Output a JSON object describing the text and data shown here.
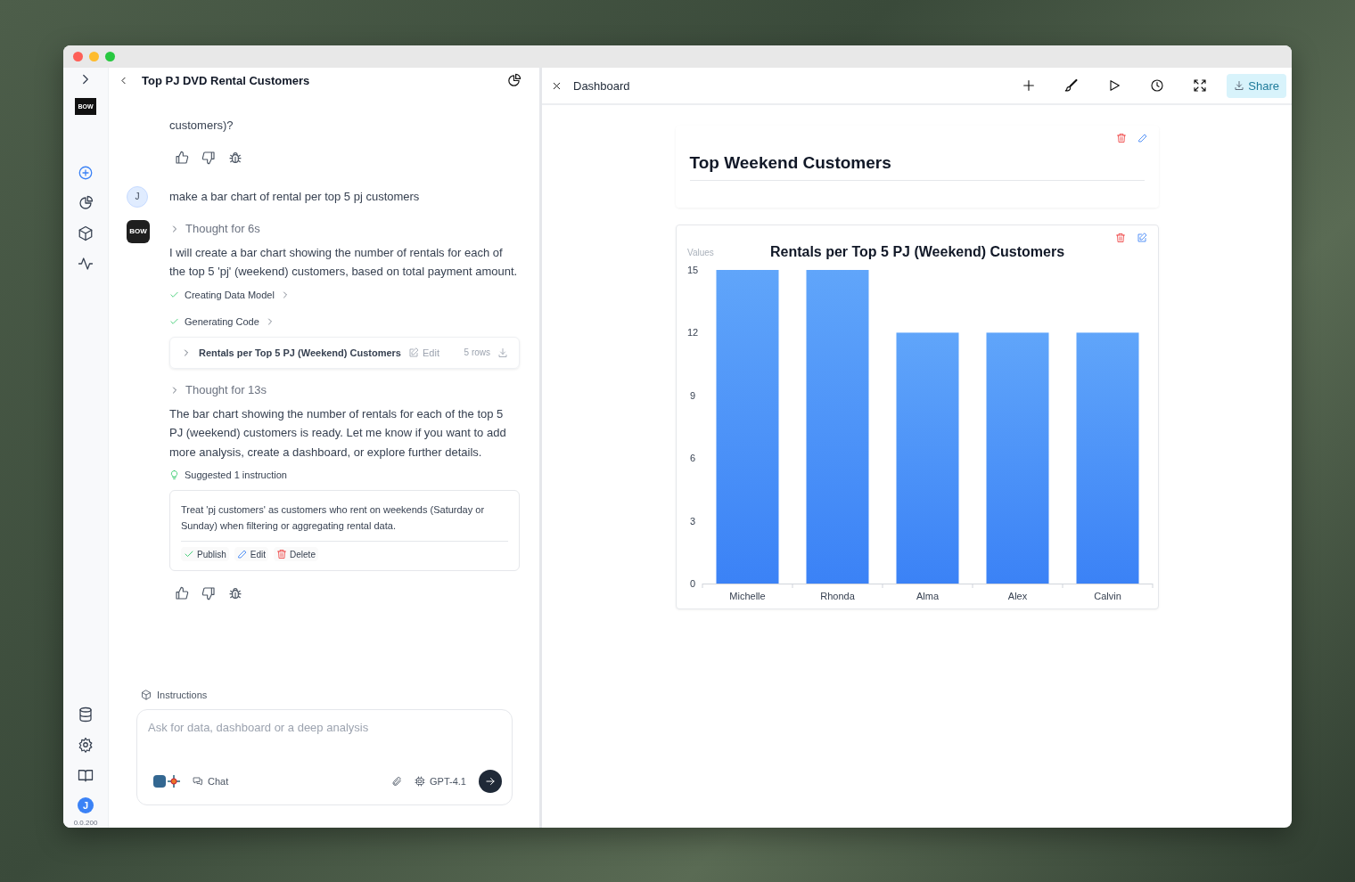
{
  "sidebar": {
    "logo": "BOW",
    "avatar": "J",
    "version": "0.0.200"
  },
  "chat": {
    "title": "Top PJ DVD Rental Customers",
    "messages": [
      {
        "kind": "assistant_tail",
        "blocks": [
          {
            "kind": "text",
            "text": "customers)?"
          },
          {
            "kind": "feedback"
          }
        ]
      },
      {
        "kind": "user",
        "avatar": "J",
        "text": "make a bar chart of rental per top 5 pj customers"
      },
      {
        "kind": "assistant",
        "avatar": "BOW",
        "blocks": [
          {
            "kind": "thought",
            "text": "Thought for 6s"
          },
          {
            "kind": "text",
            "text": "I will create a bar chart showing the number of rentals for each of the top 5 'pj' (weekend) customers, based on total payment amount."
          },
          {
            "kind": "step",
            "text": "Creating Data Model",
            "done": true
          },
          {
            "kind": "step",
            "text": "Generating Code",
            "done": true
          },
          {
            "kind": "query",
            "title": "Rentals per Top 5 PJ (Weekend) Customers",
            "edit": "Edit",
            "rows": "5 rows"
          },
          {
            "kind": "thought",
            "text": "Thought for 13s"
          },
          {
            "kind": "text",
            "text": "The bar chart showing the number of rentals for each of the top 5 PJ (weekend) customers is ready. Let me know if you want to add more analysis, create a dashboard, or explore further details."
          },
          {
            "kind": "suggestion",
            "label": "Suggested 1 instruction",
            "text": "Treat 'pj customers' as customers who rent on weekends (Saturday or Sunday) when filtering or aggregating rental data.",
            "actions": [
              {
                "kind": "publish",
                "label": "Publish"
              },
              {
                "kind": "edit",
                "label": "Edit"
              },
              {
                "kind": "delete",
                "label": "Delete"
              }
            ]
          },
          {
            "kind": "feedback"
          }
        ]
      }
    ],
    "instructions_label": "Instructions",
    "input": {
      "placeholder": "Ask for data, dashboard or a deep analysis",
      "mode": "Chat",
      "model": "GPT-4.1"
    }
  },
  "dashboard": {
    "title": "Dashboard",
    "share": "Share",
    "cards": [
      {
        "kind": "text",
        "title": "Top Weekend Customers"
      },
      {
        "kind": "chart",
        "chart_data": {
          "type": "bar",
          "title": "Rentals per Top 5 PJ (Weekend) Customers",
          "ylabel": "Values",
          "categories": [
            "Michelle",
            "Rhonda",
            "Alma",
            "Alex",
            "Calvin"
          ],
          "series": [
            {
              "color": "#3b82f6",
              "values": [
                15,
                15,
                12,
                12,
                12
              ]
            }
          ],
          "ylim": [
            0,
            15
          ],
          "yticks": [
            0,
            3,
            6,
            9,
            12,
            15
          ]
        }
      }
    ]
  }
}
